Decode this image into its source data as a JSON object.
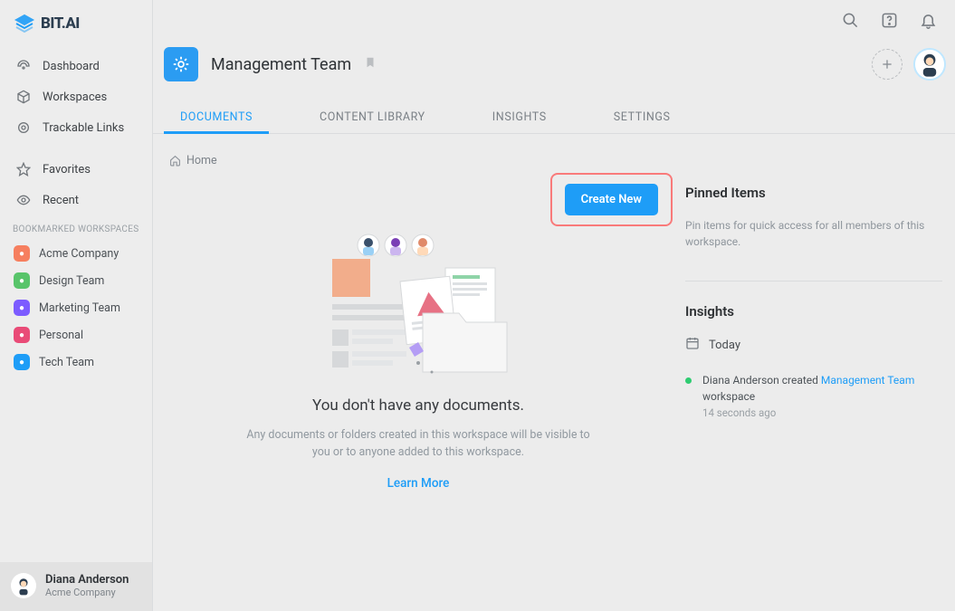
{
  "brand": {
    "name": "BIT.AI"
  },
  "sidebar": {
    "nav": [
      {
        "label": "Dashboard"
      },
      {
        "label": "Workspaces"
      },
      {
        "label": "Trackable Links"
      }
    ],
    "quick": [
      {
        "label": "Favorites"
      },
      {
        "label": "Recent"
      }
    ],
    "bookmarked_header": "BOOKMARKED WORKSPACES",
    "bookmarked": [
      {
        "label": "Acme Company",
        "color": "#f67f5f"
      },
      {
        "label": "Design Team",
        "color": "#58c46a"
      },
      {
        "label": "Marketing Team",
        "color": "#7c5cff"
      },
      {
        "label": "Personal",
        "color": "#e94b77"
      },
      {
        "label": "Tech Team",
        "color": "#1e9df7"
      }
    ]
  },
  "user": {
    "name": "Diana Anderson",
    "org": "Acme Company"
  },
  "workspace": {
    "title": "Management Team"
  },
  "tabs": [
    {
      "label": "DOCUMENTS",
      "active": true
    },
    {
      "label": "CONTENT LIBRARY"
    },
    {
      "label": "INSIGHTS"
    },
    {
      "label": "SETTINGS"
    }
  ],
  "breadcrumb": {
    "home": "Home"
  },
  "create_button": "Create New",
  "empty": {
    "title": "You don't have any documents.",
    "description": "Any documents or folders created in this workspace will be visible to you or to anyone added to this workspace.",
    "learn_more": "Learn More"
  },
  "pinned": {
    "title": "Pinned Items",
    "help": "Pin items for quick access for all members of this workspace."
  },
  "insights": {
    "title": "Insights",
    "today_label": "Today",
    "activity": {
      "prefix": "Diana Anderson created ",
      "link": "Management Team",
      "suffix": " workspace",
      "time": "14 seconds ago"
    }
  }
}
